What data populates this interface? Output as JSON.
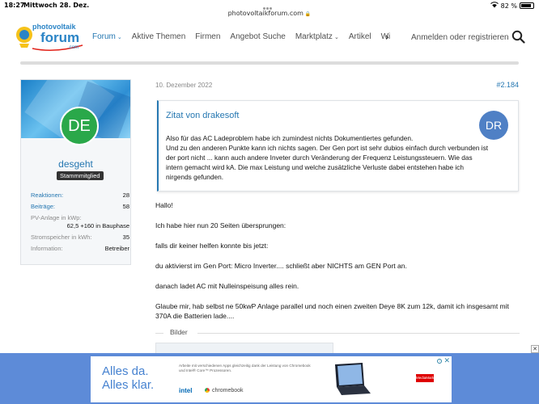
{
  "status": {
    "time": "18:27",
    "date": "Mittwoch 28. Dez.",
    "battery": "82 %",
    "url": "photovoltaikforum.com"
  },
  "header": {
    "logo_top": "photovoltaik",
    "logo_main": "forum",
    "logo_domain": ".com",
    "nav": [
      {
        "label": "Forum",
        "chevron": true,
        "active": true
      },
      {
        "label": "Aktive Themen",
        "chevron": false
      },
      {
        "label": "Firmen",
        "chevron": false
      },
      {
        "label": "Angebot Suche",
        "chevron": false
      },
      {
        "label": "Marktplatz",
        "chevron": true
      },
      {
        "label": "Artikel",
        "chevron": false
      },
      {
        "label": "Wissen",
        "chevron": false
      }
    ],
    "login_label": "Anmelden oder registrieren"
  },
  "user": {
    "initials": "DE",
    "name": "desgeht",
    "role": "Stammmitglied",
    "stats": [
      {
        "key": "Reaktionen:",
        "value": "28",
        "link": true
      },
      {
        "key": "Beiträge:",
        "value": "58",
        "link": true
      },
      {
        "key": "PV-Anlage in kWp:",
        "value": "62,5 +160 in Bauphase",
        "link": false,
        "multi": true
      },
      {
        "key": "Stromspeicher in kWh:",
        "value": "35",
        "link": false
      },
      {
        "key": "Information:",
        "value": "Betreiber",
        "link": false
      }
    ]
  },
  "post": {
    "date": "10. Dezember 2022",
    "number": "#2.184",
    "quote": {
      "title": "Zitat von drakesoft",
      "initials": "DR",
      "lines": [
        "Also für das AC Ladeproblem habe ich zumindest nichts Dokumentiertes gefunden.",
        "Und zu den anderen Punkte kann ich nichts sagen. Der Gen port ist sehr dubios einfach durch verbunden ist der port nicht ... kann auch andere Inveter durch Veränderung der Frequenz Leistungssteuern. Wie das intern gemacht wird kA. Die max Leistung und welche zusätzliche Verluste dabei entstehen habe ich nirgends gefunden."
      ]
    },
    "paragraphs": [
      "Hallo!",
      "Ich habe hier nun 20 Seiten übersprungen:",
      "falls dir keiner helfen konnte bis jetzt:",
      "du aktivierst im Gen Port: Micro Inverter.... schließt aber NICHTS am GEN Port an.",
      "danach ladet AC mit Nulleinspeisung alles rein.",
      "Glaube mir, hab selbst ne 50kwP Anlage parallel und noch einen zweiten Deye 8K zum 12k, damit ich insgesamt mit 370A die Batterien lade...."
    ],
    "images_label": "Bilder"
  },
  "ad": {
    "headline_1": "Alles da.",
    "headline_2": "Alles klar.",
    "small_text": "Arbeite mit verschiedenen Apps gleichzeitig dank der Leistung von Chromebook und Intel® Core™ Prozessoren.",
    "intel": "intel",
    "chromebook": "chromebook",
    "mediamarkt": "MediaMarkt"
  },
  "colors": {
    "accent": "#2577b1",
    "avatar_user": "#2aa84a",
    "avatar_quote": "#4f80c5",
    "ad_bg": "#5d8bd8"
  }
}
